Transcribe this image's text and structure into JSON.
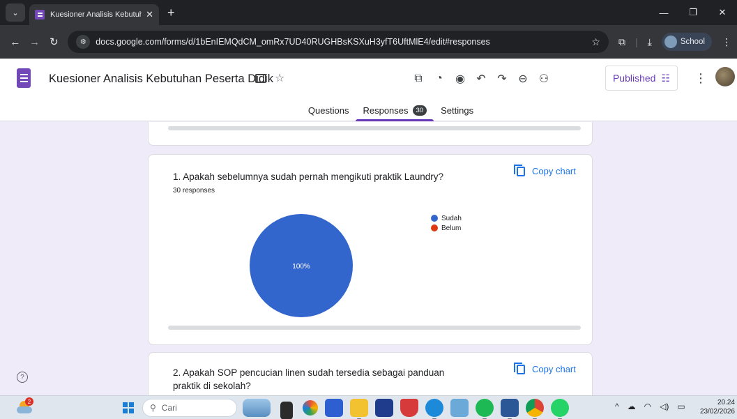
{
  "browser": {
    "tab_title": "Kuesioner Analisis Kebutuhan P",
    "url": "docs.google.com/forms/d/1bEnIEMQdCM_omRx7UD40RUGHBsKSXuH3yfT6UftMlE4/edit#responses",
    "profile_label": "School"
  },
  "form": {
    "title": "Kuesioner Analisis Kebutuhan Peserta Didik",
    "published_label": "Published",
    "tabs": {
      "questions": "Questions",
      "responses": "Responses",
      "responses_count": "30",
      "settings": "Settings"
    }
  },
  "questions": [
    {
      "title": "1. Apakah sebelumnya sudah pernah mengikuti praktik Laundry?",
      "response_count": "30 responses",
      "copy_label": "Copy chart"
    },
    {
      "title": "2. Apakah SOP pencucian linen sudah tersedia sebagai panduan praktik di sekolah?",
      "copy_label": "Copy chart"
    }
  ],
  "chart_data": {
    "type": "pie",
    "categories": [
      "Sudah",
      "Belum"
    ],
    "values": [
      100,
      0
    ],
    "data_labels": [
      "100%",
      ""
    ],
    "colors": [
      "#3366cc",
      "#dc3912"
    ],
    "legend_position": "right"
  },
  "taskbar": {
    "search_placeholder": "Cari",
    "weather_badge": "2",
    "time": "20.24",
    "date": "23/02/2026"
  }
}
